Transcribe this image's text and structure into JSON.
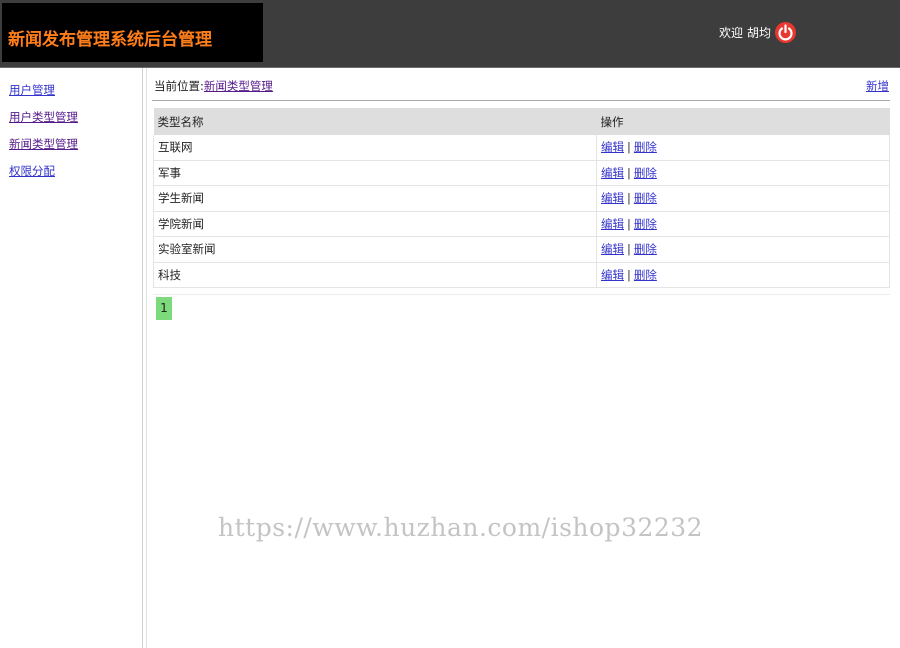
{
  "header": {
    "title": "新闻发布管理系统后台管理",
    "welcome_label": "欢迎",
    "username": "胡均",
    "logout_icon": "power-icon",
    "bg_color": "#3d3d3d",
    "title_color": "#ff7e1a"
  },
  "sidebar": {
    "items": [
      {
        "label": "用户管理"
      },
      {
        "label": "用户类型管理"
      },
      {
        "label": "新闻类型管理"
      },
      {
        "label": "权限分配"
      }
    ]
  },
  "main": {
    "breadcrumb_prefix": "当前位置:",
    "breadcrumb_link": "新闻类型管理",
    "add_label": "新增",
    "table": {
      "headers": [
        "类型名称",
        "操作"
      ],
      "rows": [
        {
          "name": "互联网",
          "edit": "编辑",
          "delete": "删除"
        },
        {
          "name": "军事",
          "edit": "编辑",
          "delete": "删除"
        },
        {
          "name": "学生新闻",
          "edit": "编辑",
          "delete": "删除"
        },
        {
          "name": "学院新闻",
          "edit": "编辑",
          "delete": "删除"
        },
        {
          "name": "实验室新闻",
          "edit": "编辑",
          "delete": "删除"
        },
        {
          "name": "科技",
          "edit": "编辑",
          "delete": "删除"
        }
      ]
    },
    "pagination": {
      "current_page": "1",
      "active_color": "#7cd97c"
    }
  },
  "watermark": "https://www.huzhan.com/ishop32232"
}
